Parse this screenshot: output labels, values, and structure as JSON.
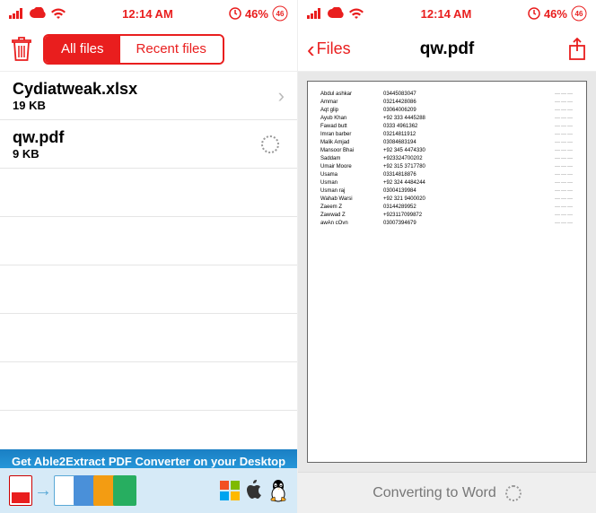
{
  "status": {
    "time": "12:14 AM",
    "battery": "46%"
  },
  "left": {
    "tabs": {
      "all": "All files",
      "recent": "Recent files"
    },
    "files": [
      {
        "name": "Cydiatweak.xlsx",
        "size": "19 KB"
      },
      {
        "name": "qw.pdf",
        "size": "9 KB"
      }
    ],
    "banner": "Get Able2Extract PDF Converter on your Desktop"
  },
  "right": {
    "back": "Files",
    "title": "qw.pdf",
    "converting": "Converting to Word",
    "pdf_rows": [
      {
        "name": "Abdul ashkar",
        "phone": "03445083047"
      },
      {
        "name": "Ammar",
        "phone": "03214428086"
      },
      {
        "name": "Aqt glip",
        "phone": "03064006209"
      },
      {
        "name": "Ayub Khan",
        "phone": "+92 333 4445288"
      },
      {
        "name": "Fawad butt",
        "phone": "0333 4961362"
      },
      {
        "name": "Imran barber",
        "phone": "03214811912"
      },
      {
        "name": "Malik Amjad",
        "phone": "03084683194"
      },
      {
        "name": "Mansoor Bhai",
        "phone": "+92 345 4474330"
      },
      {
        "name": "Saddam",
        "phone": "+923324700202"
      },
      {
        "name": "Umair Moore",
        "phone": "+92 315 3717780"
      },
      {
        "name": "Usama",
        "phone": "03314818876"
      },
      {
        "name": "Usman",
        "phone": "+92 324 4484244"
      },
      {
        "name": "Usman raj",
        "phone": "03004139984"
      },
      {
        "name": "Wahab Warsi",
        "phone": "+92 321 9400020"
      },
      {
        "name": "Zaeem Z",
        "phone": "03144289952"
      },
      {
        "name": "Zawwad Z",
        "phone": "+923117099872"
      },
      {
        "name": "awAn cOvn",
        "phone": "03007394679"
      }
    ]
  }
}
